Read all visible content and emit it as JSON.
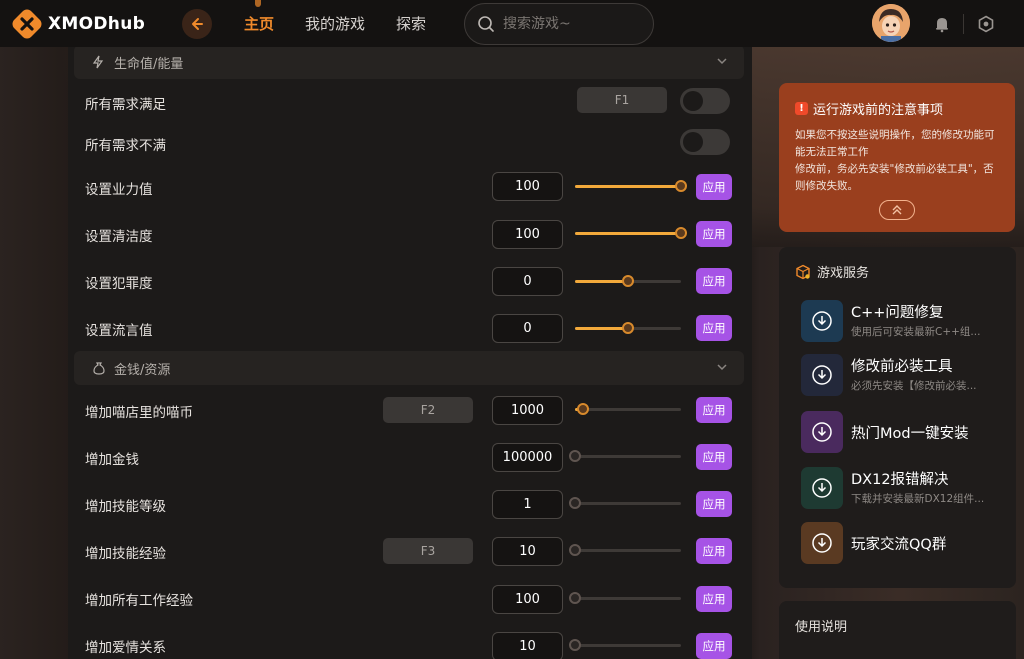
{
  "brand": {
    "name": "XMODhub",
    "accent": "#f08a2b"
  },
  "nav": {
    "home": "主页",
    "my_games": "我的游戏",
    "explore": "探索"
  },
  "search": {
    "placeholder": "搜索游戏~"
  },
  "sections": {
    "vitals": {
      "label": "生命值/能量"
    },
    "money": {
      "label": "金钱/资源"
    }
  },
  "vitals_rows": {
    "needs_full": {
      "label": "所有需求满足",
      "hotkey": "F1",
      "toggle_on": false
    },
    "needs_empty": {
      "label": "所有需求不满",
      "toggle_on": false
    },
    "karma": {
      "label": "设置业力值",
      "value": "100",
      "slider_fraction": 1.0,
      "apply": "应用"
    },
    "hygiene": {
      "label": "设置清洁度",
      "value": "100",
      "slider_fraction": 1.0,
      "apply": "应用"
    },
    "crime": {
      "label": "设置犯罪度",
      "value": "0",
      "slider_fraction": 0.5,
      "apply": "应用"
    },
    "rumor": {
      "label": "设置流言值",
      "value": "0",
      "slider_fraction": 0.5,
      "apply": "应用"
    }
  },
  "money_rows": {
    "cat_coins": {
      "label": "增加喵店里的喵币",
      "hotkey": "F2",
      "value": "1000",
      "slider_fraction": 0.08,
      "apply": "应用"
    },
    "money": {
      "label": "增加金钱",
      "value": "100000",
      "slider_fraction": 0.0,
      "apply": "应用"
    },
    "skill_level": {
      "label": "增加技能等级",
      "value": "1",
      "slider_fraction": 0.0,
      "apply": "应用"
    },
    "skill_exp": {
      "label": "增加技能经验",
      "hotkey": "F3",
      "value": "10",
      "slider_fraction": 0.0,
      "apply": "应用"
    },
    "work_exp": {
      "label": "增加所有工作经验",
      "value": "100",
      "slider_fraction": 0.0,
      "apply": "应用"
    },
    "romance": {
      "label": "增加爱情关系",
      "value": "10",
      "slider_fraction": 0.0,
      "apply": "应用"
    }
  },
  "notice": {
    "title": "运行游戏前的注意事项",
    "line1": "如果您不按这些说明操作，您的修改功能可能无法正常工作",
    "line2": "修改前，务必先安装\"修改前必装工具\"，否则修改失败。"
  },
  "services": {
    "title": "游戏服务",
    "items": [
      {
        "name": "C++问题修复",
        "desc": "使用后可安装最新C++组...",
        "color": "#1d3a52"
      },
      {
        "name": "修改前必装工具",
        "desc": "必须先安装【修改前必装...",
        "color": "#23283a"
      },
      {
        "name": "热门Mod一键安装",
        "desc": "",
        "color": "#4a2a5e"
      },
      {
        "name": "DX12报错解决",
        "desc": "下载并安装最新DX12组件...",
        "color": "#1e3a32"
      },
      {
        "name": "玩家交流QQ群",
        "desc": "",
        "color": "#5a3a22"
      }
    ]
  },
  "usage": {
    "title": "使用说明"
  }
}
